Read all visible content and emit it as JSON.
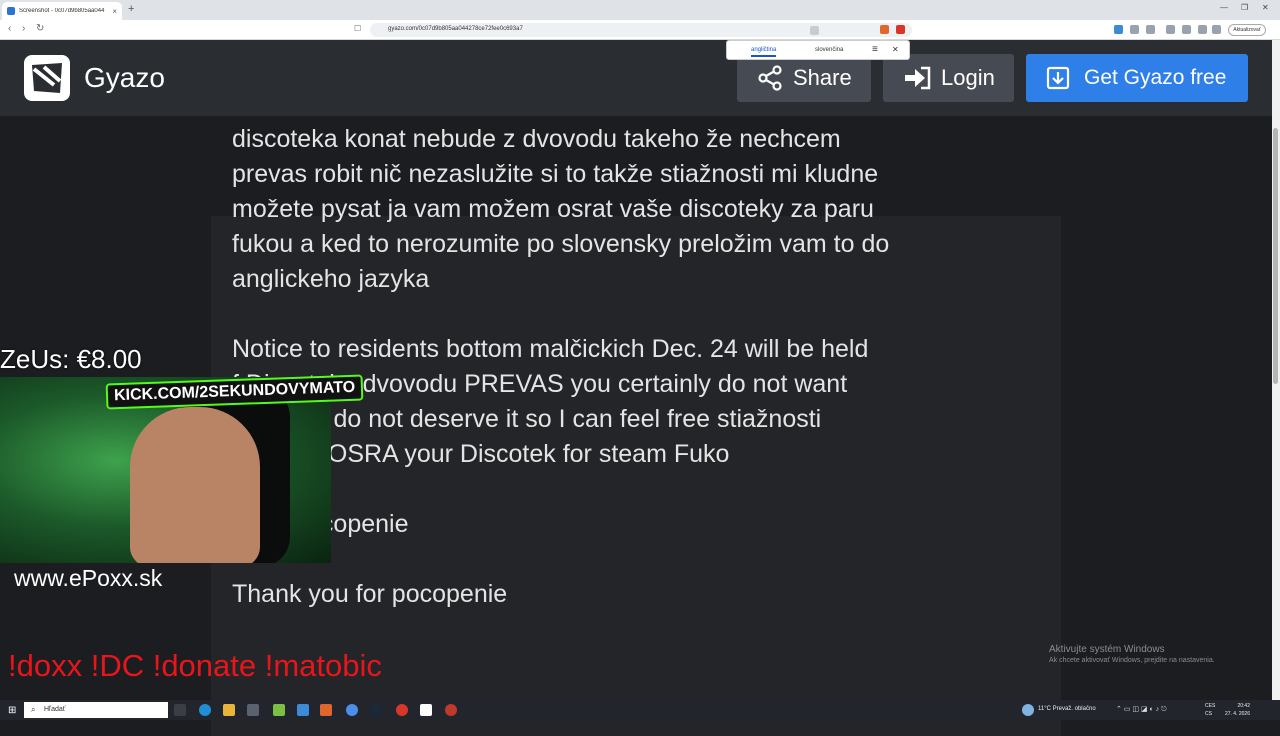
{
  "browser": {
    "tab_title": "Screenshot - 0c07d9b805aa044",
    "new_tab": "+",
    "url": "gyazo.com/0c07d9b805aa044278ce72fee0c693a7",
    "update_label": "Aktualizovať",
    "translate": {
      "lang_from": "angličtina",
      "lang_to": "slovenčina"
    }
  },
  "gyazo": {
    "logo": "Gyazo",
    "share": "Share",
    "login": "Login",
    "get": "Get Gyazo free",
    "brand_color": "#2f7fe8"
  },
  "content": {
    "lines": [
      "discoteka   konat nebude z dvovodu  takeho že nechcem",
      "prevas robit nič nezaslužite si to  takže stiažnosti mi kludne",
      "možete pysat ja vam možem osrat vaše discoteky za paru",
      "fukou a ked to nerozumite po slovensky preložim vam to do",
      "anglickeho jazyka",
      "Notice to residents bottom malčickich Dec. 24 will be held",
      "f     Discoteka dvovodu PREVAS you certainly do not want",
      "      nything I do not deserve it so I can feel free stiažnosti",
      "      he I can OSRA your Discotek for steam Fuko",
      "      m za pocopenie",
      "Thank you for pocopenie"
    ]
  },
  "windows_activation": {
    "title": "Aktivujte systém Windows",
    "subtitle": "Ak chcete aktivovať Windows, prejdite na nastavenia."
  },
  "overlay": {
    "donation": "ZeUs: €8.00",
    "kick": "KICK.COM/2SEKUNDOVYMATO",
    "site": "www.ePoxx.sk",
    "commands": "!doxx  !DC !donate !matobic"
  },
  "taskbar": {
    "search": "Hľadať",
    "weather": "11°C  Prevaž. oblačno",
    "lang": [
      "CES",
      "CS"
    ],
    "clock": [
      "20:42",
      "27. 4. 2026"
    ]
  }
}
